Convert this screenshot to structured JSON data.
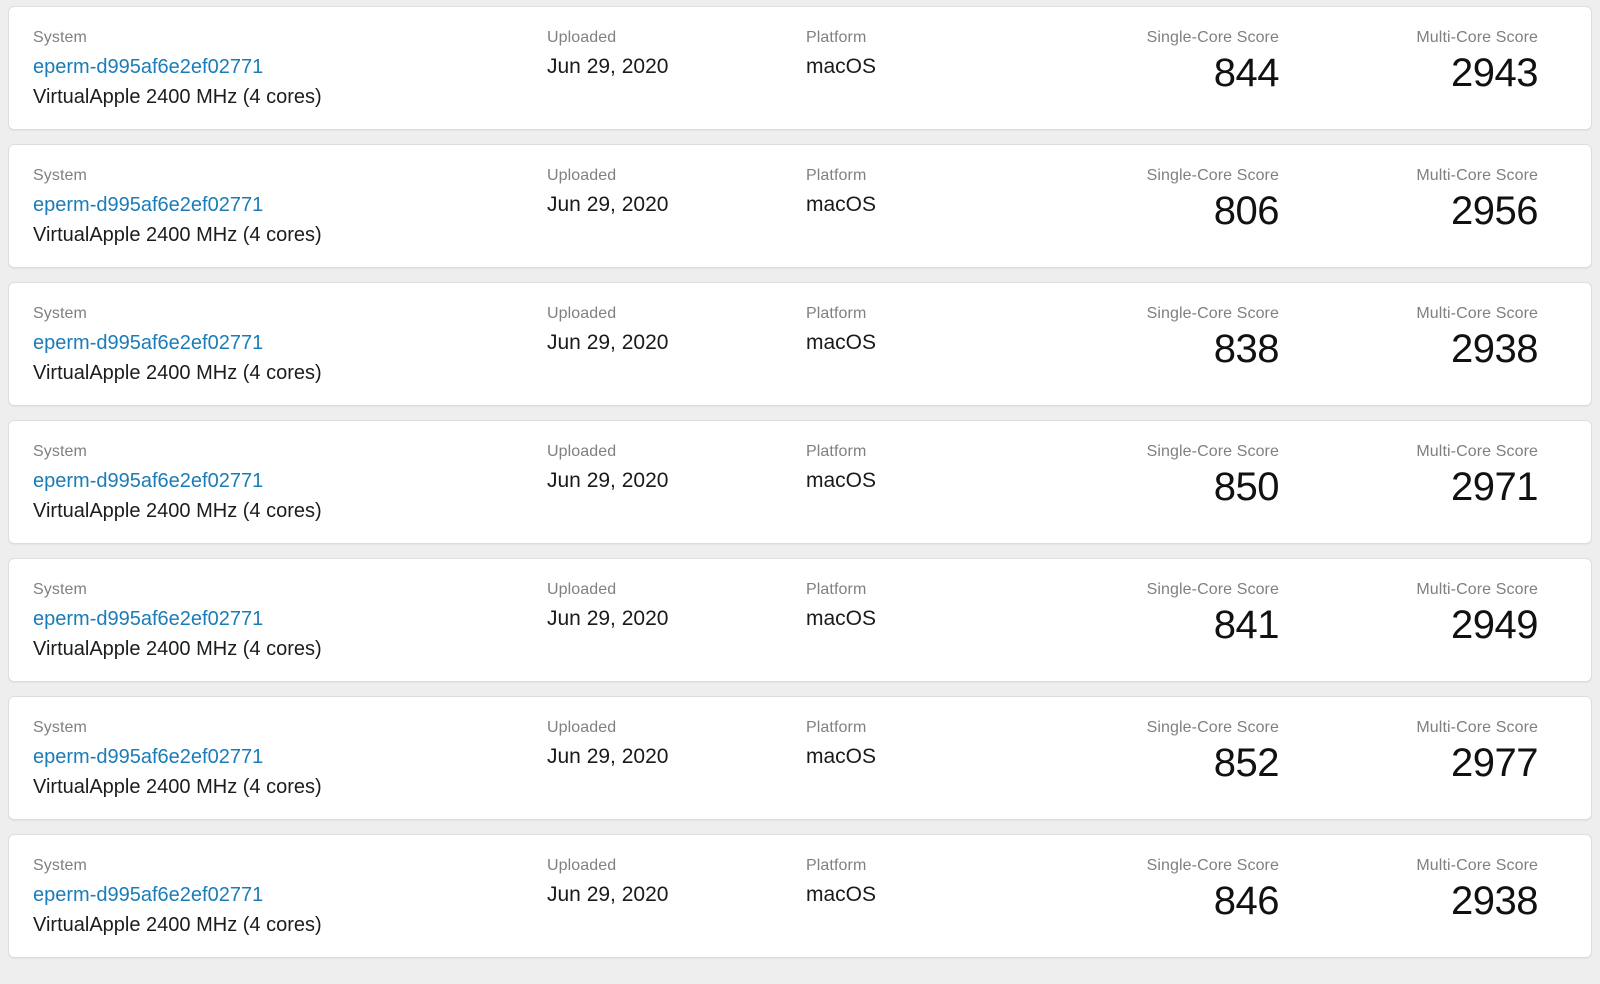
{
  "columns": {
    "system": "System",
    "uploaded": "Uploaded",
    "platform": "Platform",
    "single_core": "Single-Core Score",
    "multi_core": "Multi-Core Score"
  },
  "theme": {
    "page_background": "#eeeeee",
    "card_background": "#ffffff",
    "card_border": "#dddddd",
    "label_color": "#808080",
    "value_color": "#1a1a1a",
    "link_color": "#1a7cb8",
    "score_color": "#111111"
  },
  "results": [
    {
      "system_name": "eperm-d995af6e2ef02771",
      "system_description": "VirtualApple 2400 MHz (4 cores)",
      "uploaded": "Jun 29, 2020",
      "platform": "macOS",
      "single_core_score": "844",
      "multi_core_score": "2943"
    },
    {
      "system_name": "eperm-d995af6e2ef02771",
      "system_description": "VirtualApple 2400 MHz (4 cores)",
      "uploaded": "Jun 29, 2020",
      "platform": "macOS",
      "single_core_score": "806",
      "multi_core_score": "2956"
    },
    {
      "system_name": "eperm-d995af6e2ef02771",
      "system_description": "VirtualApple 2400 MHz (4 cores)",
      "uploaded": "Jun 29, 2020",
      "platform": "macOS",
      "single_core_score": "838",
      "multi_core_score": "2938"
    },
    {
      "system_name": "eperm-d995af6e2ef02771",
      "system_description": "VirtualApple 2400 MHz (4 cores)",
      "uploaded": "Jun 29, 2020",
      "platform": "macOS",
      "single_core_score": "850",
      "multi_core_score": "2971"
    },
    {
      "system_name": "eperm-d995af6e2ef02771",
      "system_description": "VirtualApple 2400 MHz (4 cores)",
      "uploaded": "Jun 29, 2020",
      "platform": "macOS",
      "single_core_score": "841",
      "multi_core_score": "2949"
    },
    {
      "system_name": "eperm-d995af6e2ef02771",
      "system_description": "VirtualApple 2400 MHz (4 cores)",
      "uploaded": "Jun 29, 2020",
      "platform": "macOS",
      "single_core_score": "852",
      "multi_core_score": "2977"
    },
    {
      "system_name": "eperm-d995af6e2ef02771",
      "system_description": "VirtualApple 2400 MHz (4 cores)",
      "uploaded": "Jun 29, 2020",
      "platform": "macOS",
      "single_core_score": "846",
      "multi_core_score": "2938"
    }
  ]
}
